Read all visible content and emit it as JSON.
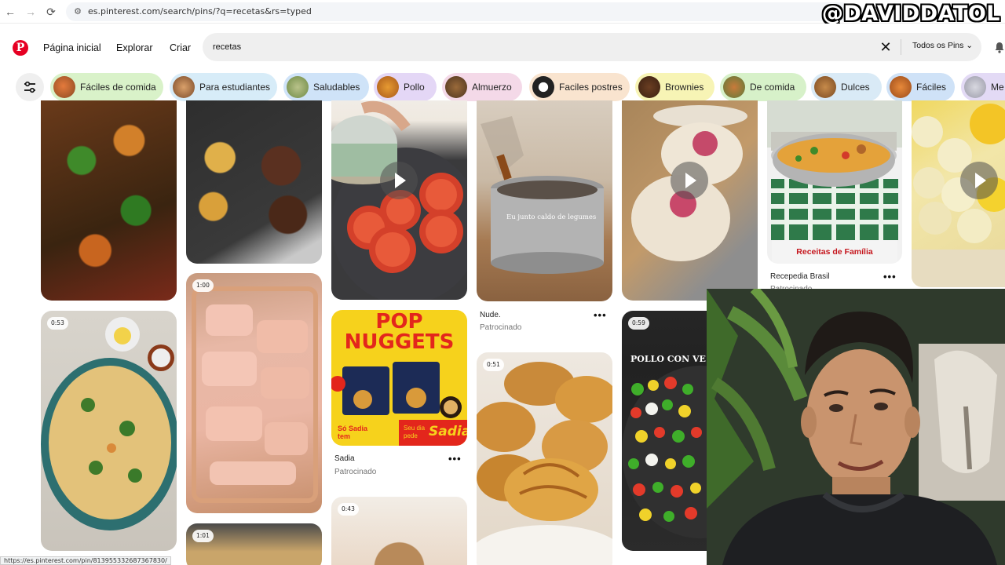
{
  "browser": {
    "url": "es.pinterest.com/search/pins/?q=recetas&rs=typed",
    "watermark": "@DAVIDDATOL",
    "status_url": "https://es.pinterest.com/pin/813955332687367830/"
  },
  "nav": {
    "home": "Página inicial",
    "explore": "Explorar",
    "create": "Criar"
  },
  "search": {
    "value": "recetas",
    "filter": "Todos os Pins"
  },
  "chips": [
    {
      "label": "Fáciles de comida",
      "bg": "#d9f2c9"
    },
    {
      "label": "Para estudiantes",
      "bg": "#d7ecf8"
    },
    {
      "label": "Saludables",
      "bg": "#cfe3f8"
    },
    {
      "label": "Pollo",
      "bg": "#e4d7f6"
    },
    {
      "label": "Almuerzo",
      "bg": "#f4d9e8"
    },
    {
      "label": "Faciles postres",
      "bg": "#f9e4cf"
    },
    {
      "label": "Brownies",
      "bg": "#f7f4b5"
    },
    {
      "label": "De comida",
      "bg": "#d7f1c9"
    },
    {
      "label": "Dulces",
      "bg": "#d9eaf6"
    },
    {
      "label": "Fáciles",
      "bg": "#cfe2f7"
    },
    {
      "label": "Me",
      "bg": "#e3daf5"
    }
  ],
  "pins": {
    "pasta_badge": "0:53",
    "chicken_badge": "1:00",
    "bottom_badge": "1:01",
    "cookie_badge": "0:43",
    "croissant_badge": "0:51",
    "pollo_badge": "0:59",
    "pot_caption": "Eu junto caldo de legumes",
    "nude_title": "Nude.",
    "nude_sub": "Patrocinado",
    "sadia_title": "Sadia",
    "sadia_sub": "Patrocinado",
    "ad_headline_1": "POP",
    "ad_headline_2": "NUGGETS",
    "ad_footer_left": "Só Sadia tem",
    "ad_footer_right": "Seu dia pede",
    "ad_brand": "Sadia",
    "recepedia_banner": "Receitas de Família",
    "recepedia_title": "Recepedia Brasil",
    "recepedia_sub": "Patrocinado",
    "pollo_caption": "POLLO CON VE"
  },
  "colors": {
    "brand": "#e60023",
    "ad_yellow": "#f6d21c",
    "ad_red": "#e3261c"
  }
}
